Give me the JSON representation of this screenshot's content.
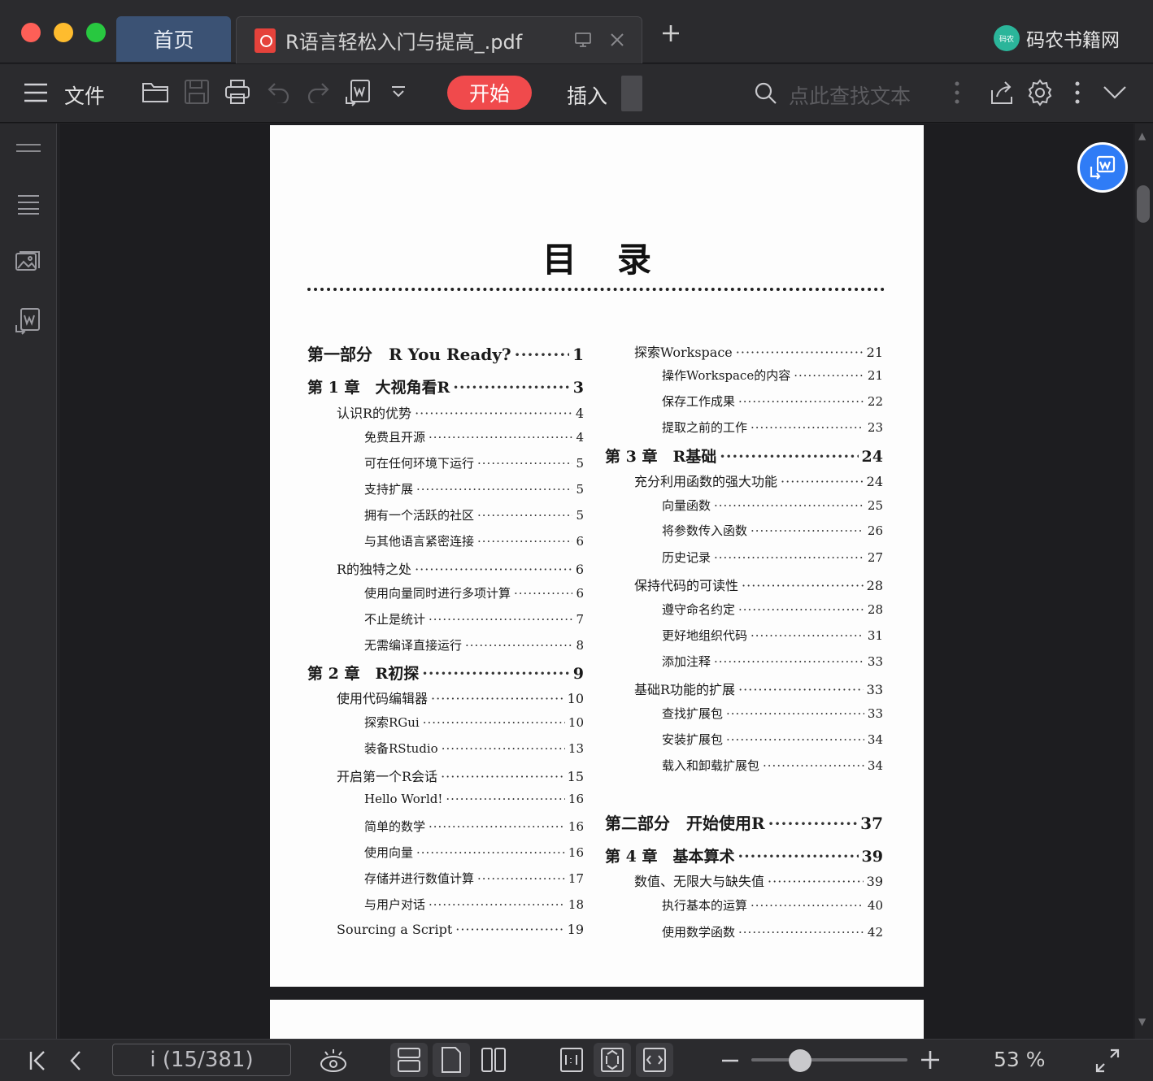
{
  "titlebar": {
    "home_tab": "首页",
    "doc_tab": "R语言轻松入门与提高_.pdf",
    "brand_logo_text": "码农",
    "brand": "码农书籍网"
  },
  "toolbar": {
    "file_label": "文件",
    "start_label": "开始",
    "insert_label": "插入",
    "search_placeholder": "点此查找文本",
    "accent_color": "#f04a4c"
  },
  "document": {
    "toc_title": "目录",
    "left_column": [
      {
        "level": "part",
        "text": "第一部分　R You Ready?",
        "page": "1"
      },
      {
        "level": "chap",
        "text": "第 1 章　大视角看R",
        "page": "3"
      },
      {
        "level": "sec",
        "text": "认识R的优势",
        "page": "4"
      },
      {
        "level": "sub",
        "text": "免费且开源",
        "page": "4"
      },
      {
        "level": "sub",
        "text": "可在任何环境下运行",
        "page": "5"
      },
      {
        "level": "sub",
        "text": "支持扩展",
        "page": "5"
      },
      {
        "level": "sub",
        "text": "拥有一个活跃的社区",
        "page": "5"
      },
      {
        "level": "sub",
        "text": "与其他语言紧密连接",
        "page": "6"
      },
      {
        "level": "sec",
        "text": "R的独特之处",
        "page": "6"
      },
      {
        "level": "sub",
        "text": "使用向量同时进行多项计算",
        "page": "6"
      },
      {
        "level": "sub",
        "text": "不止是统计",
        "page": "7"
      },
      {
        "level": "sub",
        "text": "无需编译直接运行",
        "page": "8"
      },
      {
        "level": "chap",
        "text": "第 2 章　R初探",
        "page": "9"
      },
      {
        "level": "sec",
        "text": "使用代码编辑器",
        "page": "10"
      },
      {
        "level": "sub",
        "text": "探索RGui",
        "page": "10"
      },
      {
        "level": "sub",
        "text": "装备RStudio",
        "page": "13"
      },
      {
        "level": "sec",
        "text": "开启第一个R会话",
        "page": "15"
      },
      {
        "level": "sub",
        "text": "Hello World!",
        "page": "16"
      },
      {
        "level": "sub",
        "text": "简单的数学",
        "page": "16"
      },
      {
        "level": "sub",
        "text": "使用向量",
        "page": "16"
      },
      {
        "level": "sub",
        "text": "存储并进行数值计算",
        "page": "17"
      },
      {
        "level": "sub",
        "text": "与用户对话",
        "page": "18"
      },
      {
        "level": "sec",
        "text": "Sourcing a Script",
        "page": "19"
      }
    ],
    "right_column": [
      {
        "level": "sec",
        "text": "探索Workspace",
        "page": "21"
      },
      {
        "level": "sub",
        "text": "操作Workspace的内容",
        "page": "21"
      },
      {
        "level": "sub",
        "text": "保存工作成果",
        "page": "22"
      },
      {
        "level": "sub",
        "text": "提取之前的工作",
        "page": "23"
      },
      {
        "level": "chap",
        "text": "第 3 章　R基础",
        "page": "24"
      },
      {
        "level": "sec",
        "text": "充分利用函数的强大功能",
        "page": "24"
      },
      {
        "level": "sub",
        "text": "向量函数",
        "page": "25"
      },
      {
        "level": "sub",
        "text": "将参数传入函数",
        "page": "26"
      },
      {
        "level": "sub",
        "text": "历史记录",
        "page": "27"
      },
      {
        "level": "sec",
        "text": "保持代码的可读性",
        "page": "28"
      },
      {
        "level": "sub",
        "text": "遵守命名约定",
        "page": "28"
      },
      {
        "level": "sub",
        "text": "更好地组织代码",
        "page": "31"
      },
      {
        "level": "sub",
        "text": "添加注释",
        "page": "33"
      },
      {
        "level": "sec",
        "text": "基础R功能的扩展",
        "page": "33"
      },
      {
        "level": "sub",
        "text": "查找扩展包",
        "page": "33"
      },
      {
        "level": "sub",
        "text": "安装扩展包",
        "page": "34"
      },
      {
        "level": "sub",
        "text": "载入和卸载扩展包",
        "page": "34"
      },
      {
        "level": "part",
        "text": "第二部分　开始使用R",
        "page": "37"
      },
      {
        "level": "chap",
        "text": "第 4 章　基本算术",
        "page": "39"
      },
      {
        "level": "sec",
        "text": "数值、无限大与缺失值",
        "page": "39"
      },
      {
        "level": "sub",
        "text": "执行基本的运算",
        "page": "40"
      },
      {
        "level": "sub",
        "text": "使用数学函数",
        "page": "42"
      }
    ]
  },
  "statusbar": {
    "page_indicator": "i (15/381)",
    "zoom": "53 %",
    "zoom_fraction": 0.53
  }
}
